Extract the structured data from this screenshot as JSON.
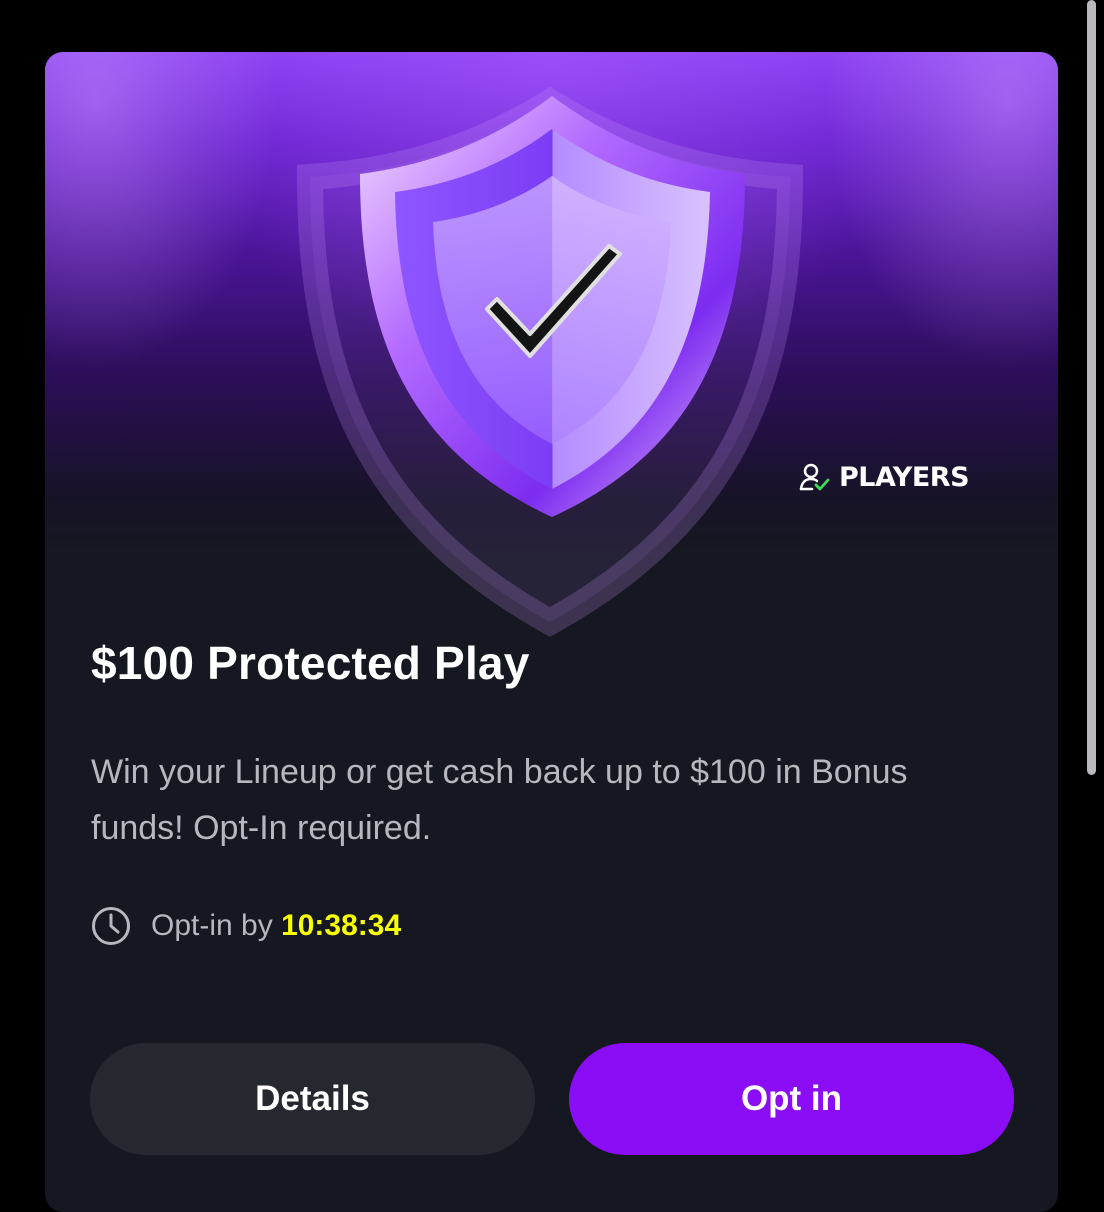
{
  "promo": {
    "brand": "PLAYERS",
    "title": "$100 Protected Play",
    "description": "Win your Lineup or get cash back up to $100 in Bonus funds! Opt-In required.",
    "deadline_label": "Opt-in by",
    "deadline_value": "10:38:34",
    "icons": {
      "hero": "shield-check-icon",
      "brand": "user-check-icon",
      "timer": "clock-icon"
    }
  },
  "actions": {
    "details_label": "Details",
    "optin_label": "Opt in"
  },
  "colors": {
    "accent": "#8a0df5",
    "timer_highlight": "#f7ff00",
    "card_bg": "#161821"
  }
}
